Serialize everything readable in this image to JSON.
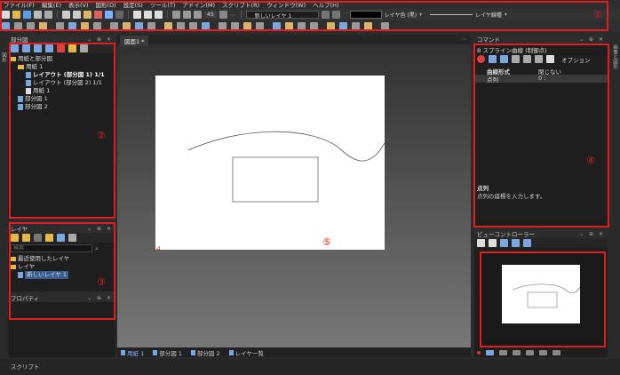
{
  "menu": [
    "ファイル(F)",
    "編集(E)",
    "表示(V)",
    "図形(D)",
    "設定(S)",
    "ツール(T)",
    "アドイン(M)",
    "スクリプト(R)",
    "ウィンドウ(W)",
    "ヘルプ(H)"
  ],
  "toolbar": {
    "zoom_value": "45",
    "layer_select": "新しいレイヤ 1",
    "layer_color_label": "レイヤ色 (黒)",
    "line_type_label": "レイヤ線種"
  },
  "left_tab": "図形",
  "right_tab": "画像と図形",
  "part_panel": {
    "title": "部分図",
    "tree": [
      {
        "label": "用紙と部分図",
        "level": 0,
        "kind": "folder"
      },
      {
        "label": "用紙 1",
        "level": 1,
        "kind": "folder"
      },
      {
        "label": "レイアウト (部分図 1)  1/1",
        "level": 2,
        "kind": "doc",
        "selected": true
      },
      {
        "label": "レイアウト (部分図 2)  1/1",
        "level": 2,
        "kind": "doc"
      },
      {
        "label": "用紙 1",
        "level": 2,
        "kind": "page"
      },
      {
        "label": "部分図 1",
        "level": 1,
        "kind": "doc"
      },
      {
        "label": "部分図 2",
        "level": 1,
        "kind": "doc"
      }
    ]
  },
  "layer_panel": {
    "title": "レイヤ",
    "search_placeholder": "検索",
    "tree": [
      {
        "label": "最近使用したレイヤ",
        "level": 0
      },
      {
        "label": "レイヤ",
        "level": 0
      },
      {
        "label": "新しいレイヤ 1",
        "level": 1,
        "selected": true
      }
    ]
  },
  "property_panel": {
    "title": "プロパティ"
  },
  "canvas": {
    "tab_title": "図面1 *",
    "bottom_tabs": [
      "用紙 1",
      "部分図 1",
      "部分図 2",
      "レイヤ一覧"
    ]
  },
  "command_panel": {
    "title": "コマンド",
    "command_name": "B スプライン曲線 (制御点)",
    "option_label": "オプション",
    "rows": [
      {
        "key": "曲線形式",
        "value": "閉じない"
      },
      {
        "key": "点列",
        "value": "0 :"
      }
    ],
    "help_title": "点列",
    "help_text": "点列の座標を入力します。"
  },
  "view_controller": {
    "title": "ビューコントローラー"
  },
  "status_bar": {
    "label": "スクリプト"
  },
  "annotations": [
    "①",
    "②",
    "③",
    "④",
    "⑤"
  ],
  "colors": {
    "annotation": "#e02020",
    "selection": "#3a5f8f",
    "canvas_bg_top": "#2c2c2c",
    "canvas_bg_bottom": "#7a7a7a"
  }
}
